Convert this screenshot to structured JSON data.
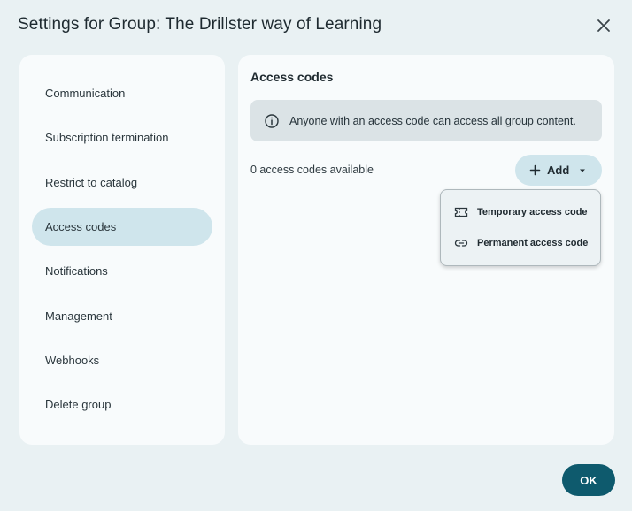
{
  "dialog": {
    "title": "Settings for Group: The Drillster way of Learning",
    "close_icon": "close-icon",
    "ok_label": "OK",
    "accent_color": "#0e5a6d"
  },
  "sidebar": {
    "items": [
      {
        "label": "Communication",
        "active": false
      },
      {
        "label": "Subscription termination",
        "active": false
      },
      {
        "label": "Restrict to catalog",
        "active": false
      },
      {
        "label": "Access codes",
        "active": true
      },
      {
        "label": "Notifications",
        "active": false
      },
      {
        "label": "Management",
        "active": false
      },
      {
        "label": "Webhooks",
        "active": false
      },
      {
        "label": "Delete group",
        "active": false
      }
    ]
  },
  "main": {
    "section_title": "Access codes",
    "info_text": "Anyone with an access code can access all group content.",
    "info_icon": "info-icon",
    "count_text": "0 access codes available",
    "add_button": {
      "label": "Add",
      "icon": "plus-icon",
      "caret": "caret-down-icon"
    },
    "add_menu": [
      {
        "label": "Temporary access code",
        "icon": "ticket-icon"
      },
      {
        "label": "Permanent access code",
        "icon": "link-icon"
      }
    ]
  }
}
